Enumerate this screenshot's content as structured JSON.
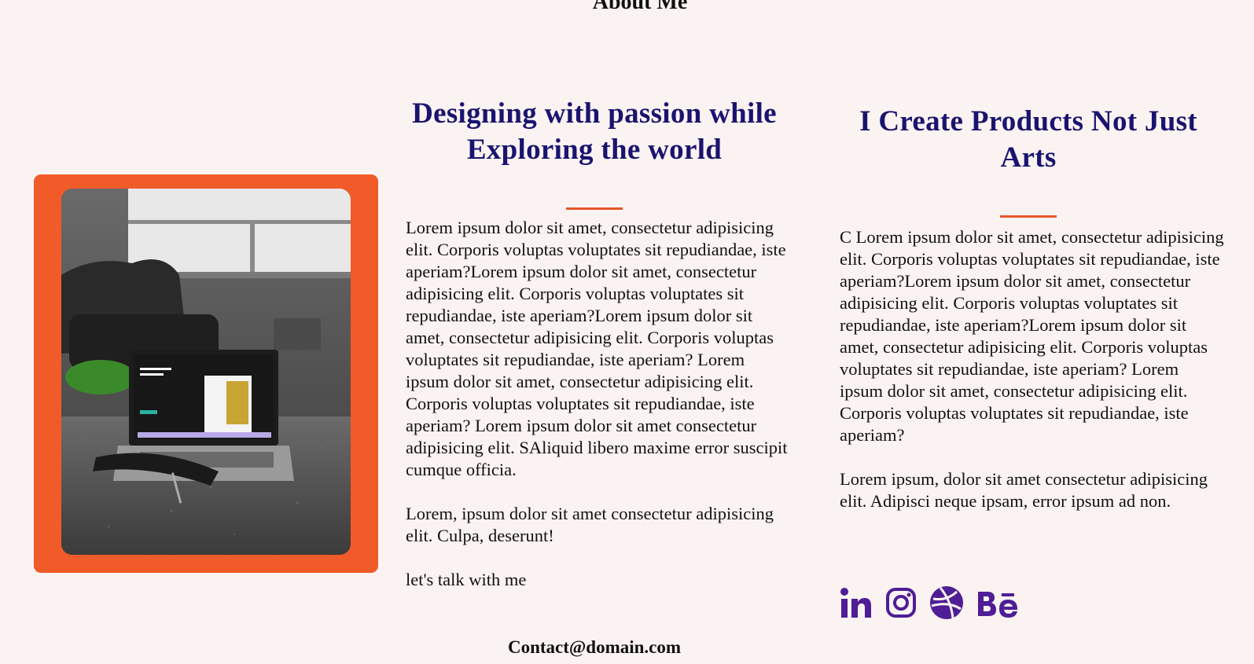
{
  "about": {
    "title": "About Me"
  },
  "left_column": {
    "heading": "Designing with passion while Exploring the world",
    "paragraphs": [
      "Lorem ipsum dolor sit amet, consectetur adipisicing elit. Corporis voluptas voluptates sit repudiandae, iste aperiam?Lorem ipsum dolor sit amet, consectetur adipisicing elit. Corporis voluptas voluptates sit repudiandae, iste aperiam?Lorem ipsum dolor sit amet, consectetur adipisicing elit. Corporis voluptas voluptates sit repudiandae, iste aperiam? Lorem ipsum dolor sit amet, consectetur adipisicing elit. Corporis voluptas voluptates sit repudiandae, iste aperiam? Lorem ipsum dolor sit amet consectetur adipisicing elit. SAliquid libero maxime error suscipit cumque officia.",
      "Lorem, ipsum dolor sit amet consectetur adipisicing elit. Culpa, deserunt!",
      "let's talk with me"
    ]
  },
  "right_column": {
    "heading": "I Create Products Not Just Arts",
    "paragraphs": [
      "C Lorem ipsum dolor sit amet, consectetur adipisicing elit. Corporis voluptas voluptates sit repudiandae, iste aperiam?Lorem ipsum dolor sit amet, consectetur adipisicing elit. Corporis voluptas voluptates sit repudiandae, iste aperiam?Lorem ipsum dolor sit amet, consectetur adipisicing elit. Corporis voluptas voluptates sit repudiandae, iste aperiam? Lorem ipsum dolor sit amet, consectetur adipisicing elit. Corporis voluptas voluptates sit repudiandae, iste aperiam?",
      "Lorem ipsum, dolor sit amet consectetur adipisicing elit. Adipisci neque ipsam, error ipsum ad non."
    ]
  },
  "contact": {
    "email": "Contact@domain.com"
  },
  "socials": [
    {
      "icon": "linkedin-icon"
    },
    {
      "icon": "instagram-icon"
    },
    {
      "icon": "dribbble-icon"
    },
    {
      "icon": "behance-icon"
    }
  ],
  "colors": {
    "background": "#faf3f1",
    "accent_orange": "#f15a29",
    "heading_navy": "#1a1470",
    "icon_purple": "#4f1d96"
  }
}
